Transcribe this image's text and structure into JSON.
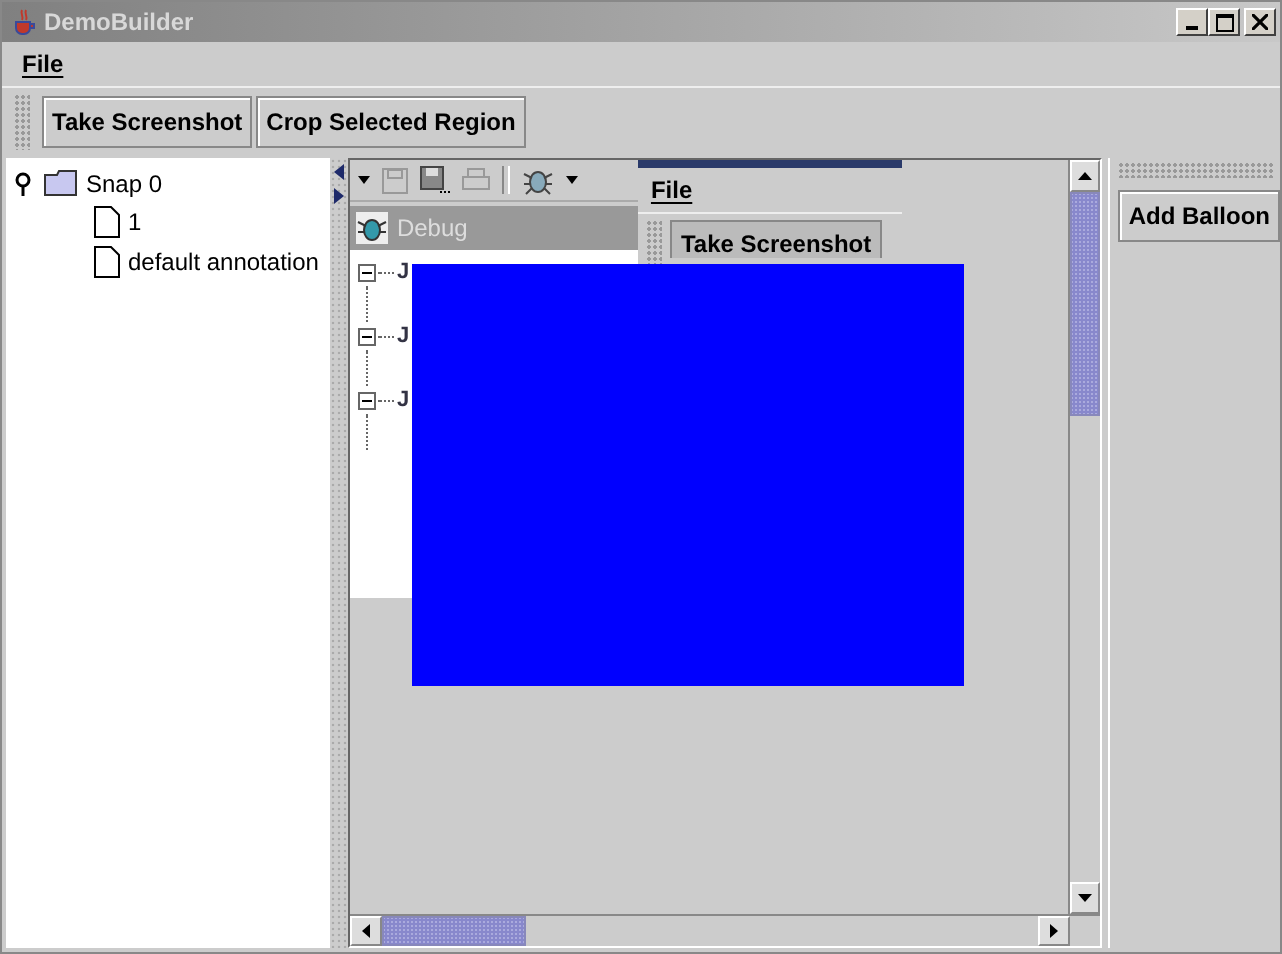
{
  "window": {
    "title": "DemoBuilder"
  },
  "menu": [
    {
      "label": "File"
    }
  ],
  "toolbar": [
    {
      "label": "Take Screenshot"
    },
    {
      "label": "Crop Selected Region"
    }
  ],
  "tree": [
    {
      "label": "Snap 0",
      "kind": "folder",
      "expanded": true,
      "children": [
        {
          "label": "1",
          "kind": "document"
        },
        {
          "label": "default annotation",
          "kind": "document"
        }
      ]
    }
  ],
  "captured": {
    "panel_title": "Debug",
    "tree": [
      {
        "label": "J",
        "expanded": true
      },
      {
        "label": "J",
        "expanded": true
      },
      {
        "label": "J",
        "expanded": true
      }
    ],
    "menu": [
      {
        "label": "File"
      }
    ],
    "button": "Take Screenshot"
  },
  "side_buttons": [
    {
      "label": "Add Balloon"
    }
  ]
}
